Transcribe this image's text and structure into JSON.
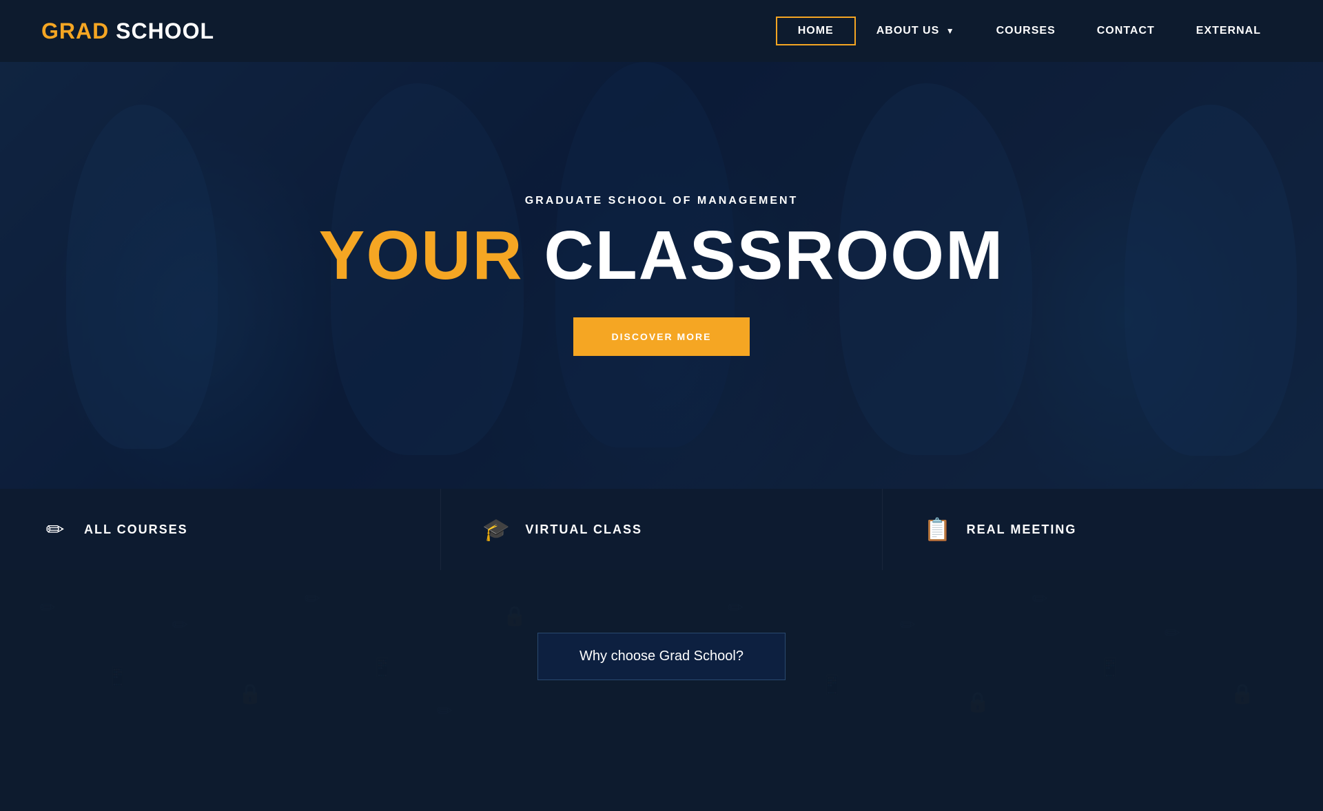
{
  "logo": {
    "grad": "GRAD",
    "school": "SCHOOL"
  },
  "nav": {
    "items": [
      {
        "label": "HOME",
        "active": true
      },
      {
        "label": "ABOUT US",
        "active": false,
        "dropdown": true
      },
      {
        "label": "COURSES",
        "active": false
      },
      {
        "label": "CONTACT",
        "active": false
      },
      {
        "label": "EXTERNAL",
        "active": false
      }
    ]
  },
  "hero": {
    "subtitle": "GRADUATE SCHOOL OF MANAGEMENT",
    "title_your": "YOUR",
    "title_classroom": "CLASSROOM",
    "cta_label": "DISCOVER MORE"
  },
  "features": [
    {
      "icon": "✏️",
      "label": "ALL COURSES"
    },
    {
      "icon": "🎓",
      "label": "VIRTUAL CLASS"
    },
    {
      "icon": "📋",
      "label": "REAL MEETING"
    }
  ],
  "why": {
    "label": "Why choose Grad School?"
  },
  "colors": {
    "accent": "#f5a623",
    "dark_bg": "#0d1b2e",
    "card_bg": "#0d1b30",
    "white": "#ffffff"
  }
}
